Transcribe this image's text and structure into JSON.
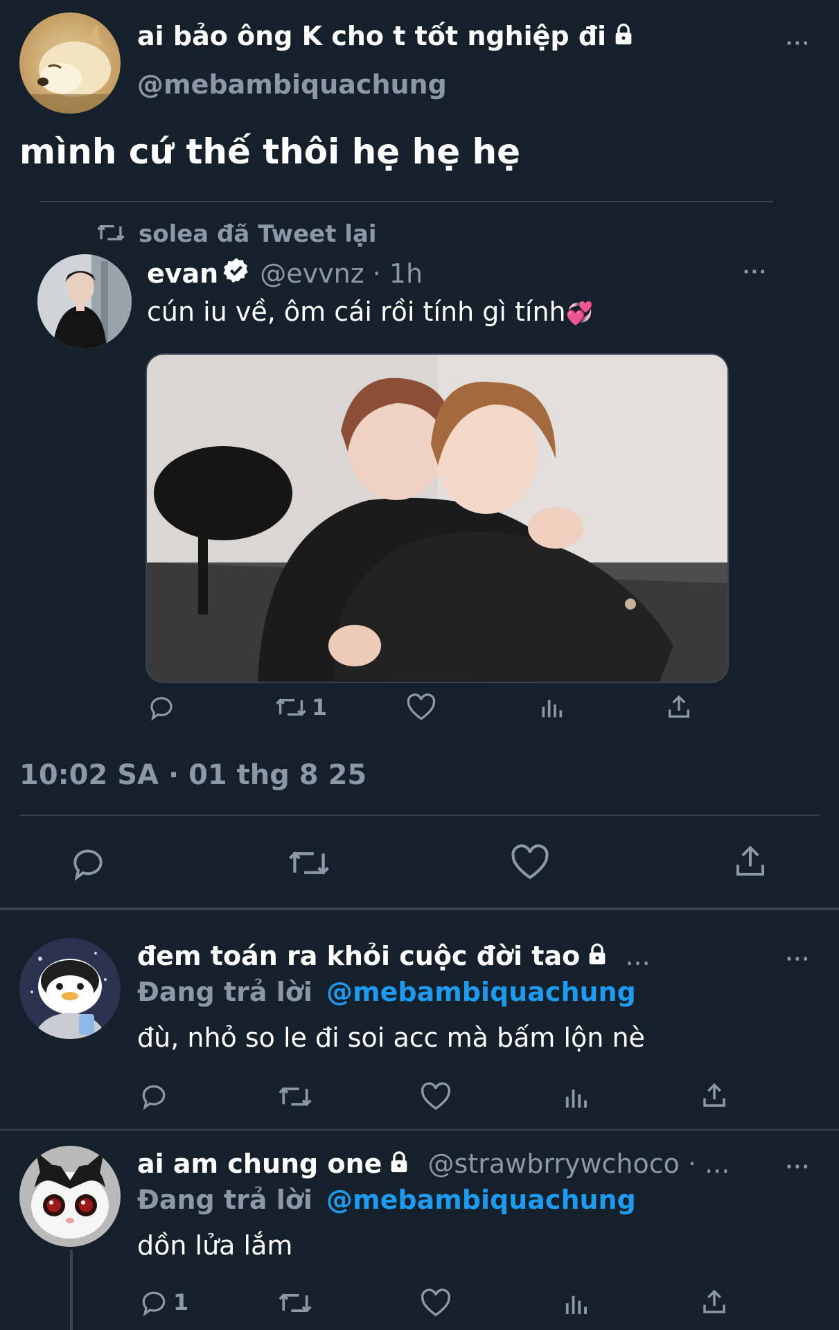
{
  "main_tweet": {
    "display_name": "ai bảo ông K cho t tốt nghiệp đi",
    "handle": "@mebambiquachung",
    "text": "mình cứ thế thôi hẹ hẹ hẹ",
    "timestamp": "10:02 SA · 01 thg 8 25",
    "more": "···"
  },
  "retweet": {
    "retweeted_by": "solea đã Tweet lại",
    "display_name": "evan",
    "handle": "@evvnz",
    "time": "· 1h",
    "text": "cún iu về, ôm cái rồi tính gì tính",
    "emoji": "💞",
    "retweet_count": "1",
    "more": "···"
  },
  "replies": [
    {
      "display_name": "đem toán ra khỏi cuộc đời tao",
      "suffix": "...",
      "replying_label": "Đang trả lời",
      "replying_to": "@mebambiquachung",
      "text": "đù, nhỏ so le đi soi acc mà bấm lộn nè",
      "more": "···"
    },
    {
      "display_name": "ai am chung one",
      "handle": "@strawbrrywchoco · ...",
      "replying_label": "Đang trả lời",
      "replying_to": "@mebambiquachung",
      "text": "dồn lửa lắm",
      "reply_count": "1",
      "more": "···"
    }
  ],
  "colors": {
    "background": "#15202b",
    "muted": "#8b98a5",
    "link": "#1d9bf0",
    "divider": "#38444d"
  },
  "icons": [
    "lock-icon",
    "verified-icon",
    "retweet-icon",
    "reply-icon",
    "like-icon",
    "analytics-icon",
    "share-icon",
    "more-icon"
  ]
}
